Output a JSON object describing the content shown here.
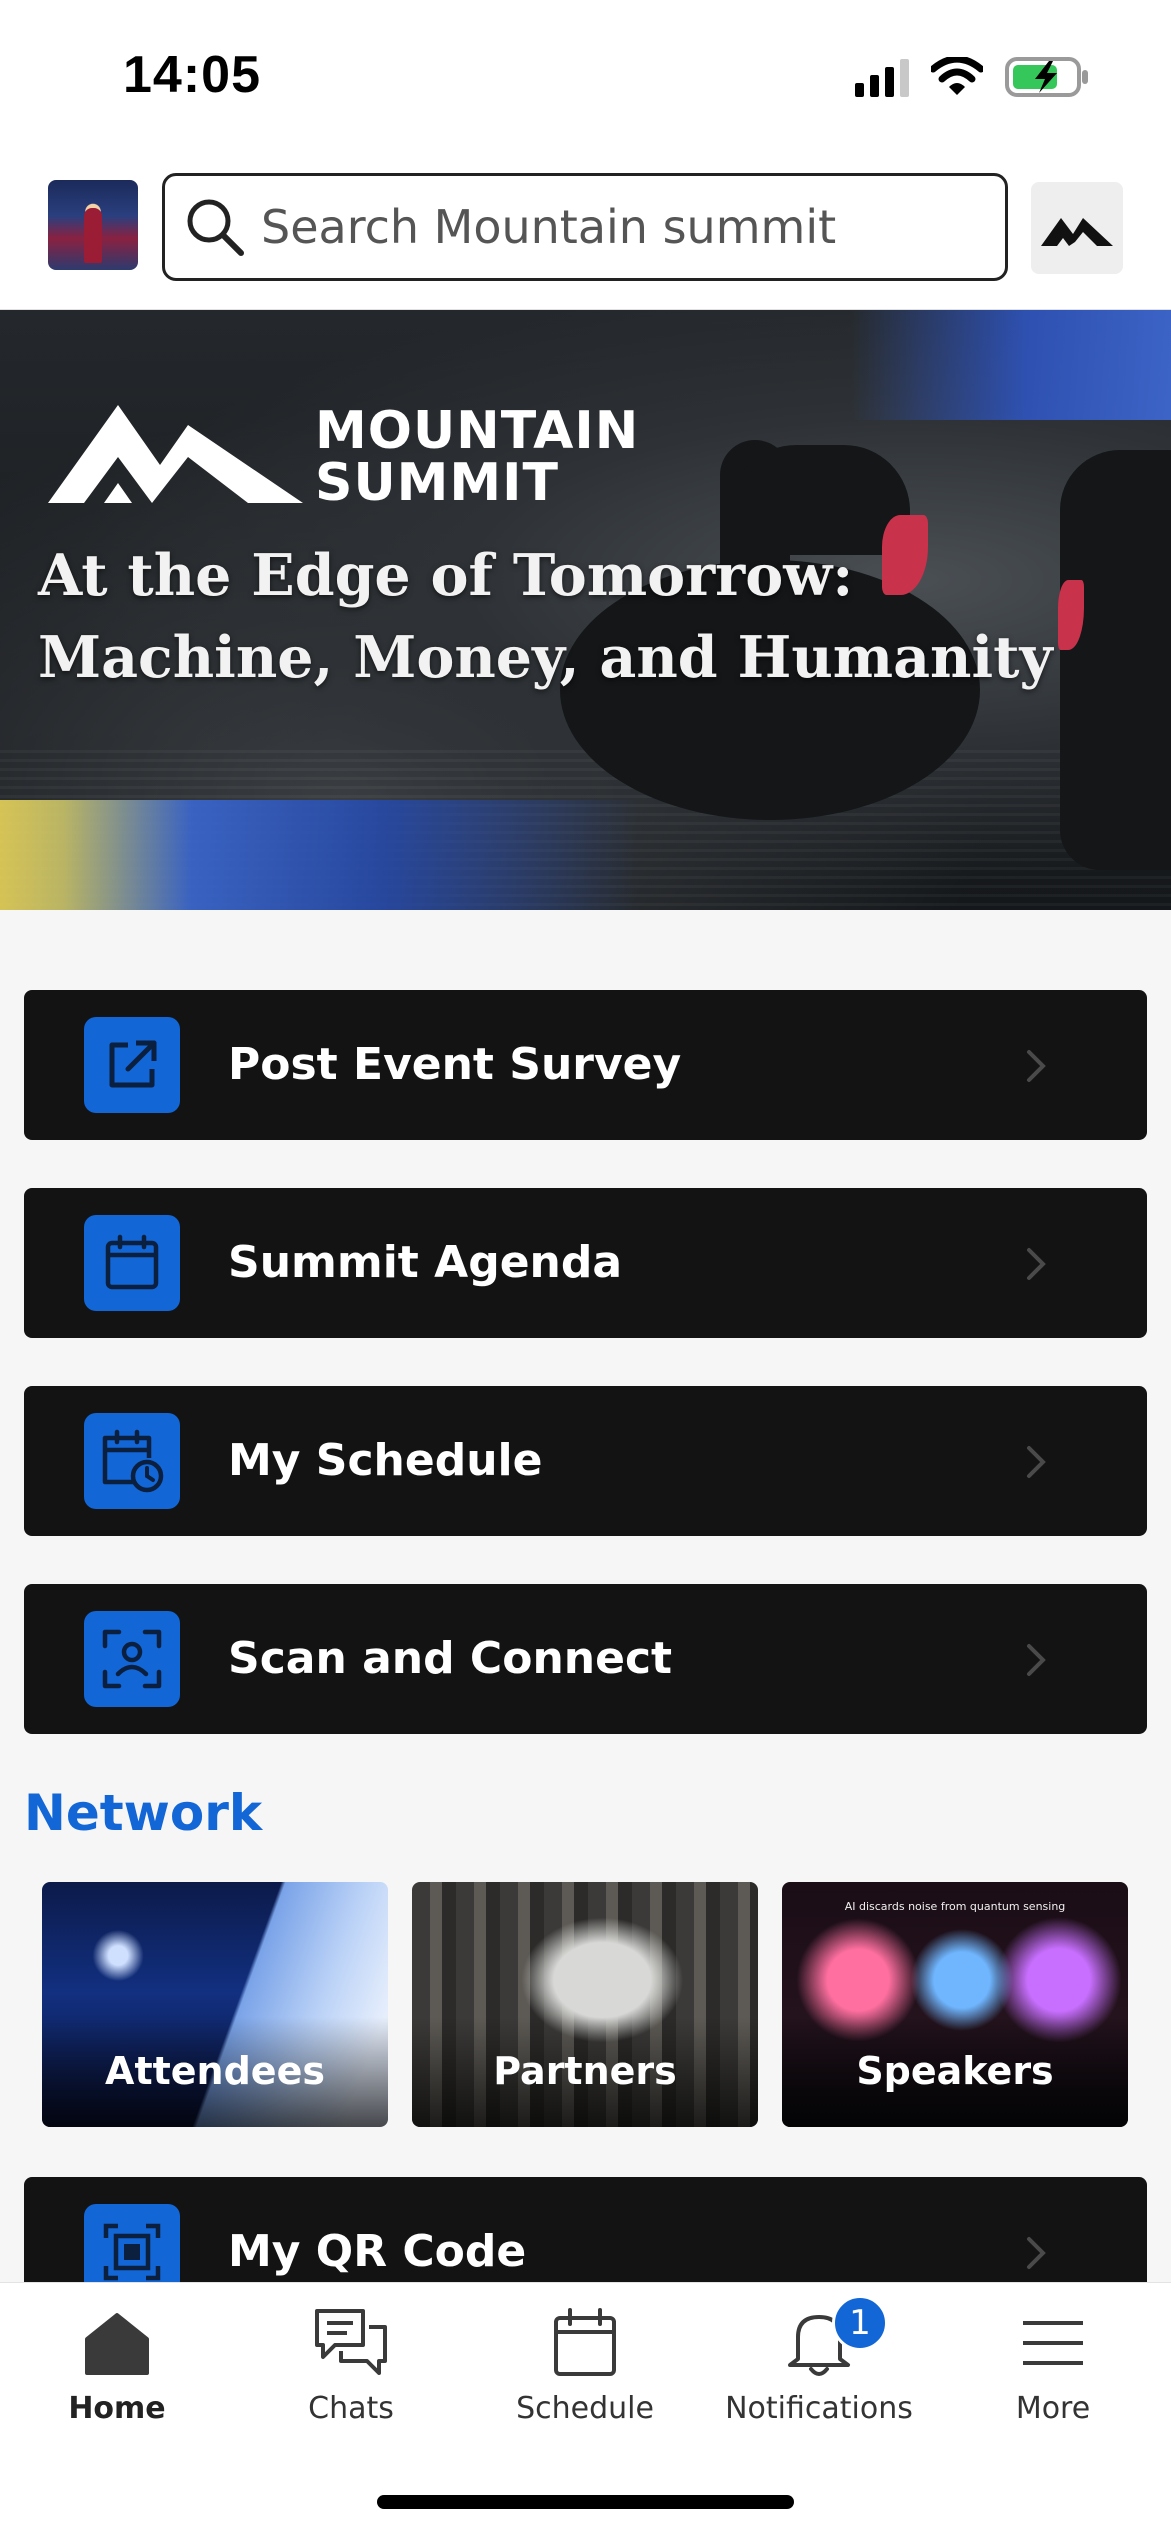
{
  "status_bar": {
    "time": "14:05"
  },
  "header": {
    "search_placeholder": "Search Mountain summit",
    "icons": [
      "avatar",
      "search-icon",
      "mountain-logo-icon"
    ]
  },
  "banner": {
    "brand_line1": "MOUNTAIN",
    "brand_line2": "SUMMIT",
    "headline_line1": "At the Edge of Tomorrow:",
    "headline_line2": "Machine, Money, and Humanity"
  },
  "menu": {
    "items": [
      {
        "label": "Post Event Survey",
        "icon": "external-link-icon"
      },
      {
        "label": "Summit Agenda",
        "icon": "calendar-icon"
      },
      {
        "label": "My Schedule",
        "icon": "calendar-clock-icon"
      },
      {
        "label": "Scan and Connect",
        "icon": "face-scan-icon"
      },
      {
        "label": "My QR Code",
        "icon": "qr-code-icon"
      }
    ]
  },
  "network": {
    "title": "Network",
    "tiles": [
      {
        "label": "Attendees"
      },
      {
        "label": "Partners"
      },
      {
        "label": "Speakers",
        "caption": "AI discards noise from quantum sensing"
      }
    ]
  },
  "bottom_nav": {
    "items": [
      {
        "label": "Home",
        "icon": "home-icon",
        "active": true
      },
      {
        "label": "Chats",
        "icon": "chat-bubbles-icon"
      },
      {
        "label": "Schedule",
        "icon": "calendar-icon"
      },
      {
        "label": "Notifications",
        "icon": "bell-icon",
        "badge": "1"
      },
      {
        "label": "More",
        "icon": "hamburger-menu-icon"
      }
    ]
  },
  "colors": {
    "accent": "#1266d6",
    "card_bg": "#131313",
    "page_bg": "#f6f6f6"
  }
}
